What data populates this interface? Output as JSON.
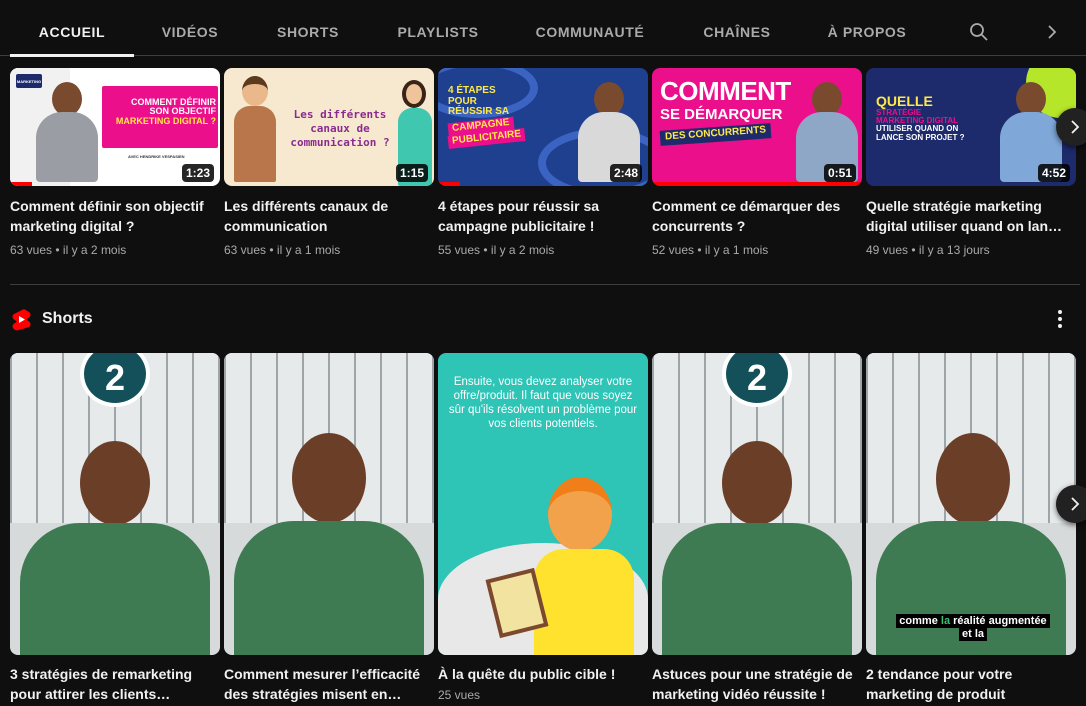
{
  "tabs": [
    {
      "label": "ACCUEIL"
    },
    {
      "label": "VIDÉOS"
    },
    {
      "label": "SHORTS"
    },
    {
      "label": "PLAYLISTS"
    },
    {
      "label": "COMMUNAUTÉ"
    },
    {
      "label": "CHAÎNES"
    },
    {
      "label": "À PROPOS"
    }
  ],
  "tab_icons": {
    "search": "search-icon",
    "next": "chevron-right-icon"
  },
  "videos": [
    {
      "title": "Comment définir son objectif marketing digital ?",
      "views": "63 vues",
      "age": "il y a 2 mois",
      "duration": "1:23",
      "watched": 0.1,
      "thumb_text": [
        "COMMENT DÉFINIR",
        "SON OBJECTIF",
        "MARKETING DIGITAL ?"
      ],
      "thumb_sub": "AVEC HENDRIKE VESPASIEN",
      "thumb_logo": "MARKETING"
    },
    {
      "title": "Les différents canaux de communication",
      "views": "63 vues",
      "age": "il y a 1 mois",
      "duration": "1:15",
      "watched": 0,
      "thumb_text": [
        "Les différents",
        "canaux de",
        "communication ?"
      ]
    },
    {
      "title": "4 étapes pour réussir sa campagne publicitaire !",
      "views": "55 vues",
      "age": "il y a 2 mois",
      "duration": "2:48",
      "watched": 0.1,
      "thumb_text": [
        "4 ÉTAPES",
        "POUR",
        "RÉUSSIR SA",
        "CAMPAGNE",
        "PUBLICITAIRE"
      ]
    },
    {
      "title": "Comment ce démarquer des concurrents ?",
      "views": "52 vues",
      "age": "il y a 1 mois",
      "duration": "0:51",
      "watched": 1,
      "thumb_text": [
        "COMMENT",
        "SE DÉMARQUER",
        "DES CONCURRENTS"
      ]
    },
    {
      "title": "Quelle stratégie marketing digital utiliser quand on lan…",
      "views": "49 vues",
      "age": "il y a 13 jours",
      "duration": "4:52",
      "watched": 0,
      "thumb_text": [
        "QUELLE",
        "STRATÉGIE",
        "MARKETING DIGITAL",
        "UTILISER QUAND ON",
        "LANCE SON PROJET ?"
      ]
    }
  ],
  "meta_separator": "•",
  "shorts_shelf": {
    "title": "Shorts",
    "icon": "shorts-logo-icon",
    "menu_icon": "more-vert-icon"
  },
  "shorts": [
    {
      "title": "3 stratégies de remarketing pour attirer les clients…",
      "badge": "2"
    },
    {
      "title": "Comment mesurer l’efficacité des stratégies misent en…"
    },
    {
      "title": "À la quête du public cible !",
      "views": "25 vues",
      "overlay_text": "Ensuite, vous devez analyser votre offre/produit. Il faut que vous soyez sûr qu'ils résolvent un problème pour vos clients potentiels."
    },
    {
      "title": "Astuces pour une stratégie de marketing vidéo réussite !",
      "badge": "2"
    },
    {
      "title": "2 tendance pour votre marketing de produit",
      "caption_line1_a": "comme",
      "caption_line1_b": "la",
      "caption_line1_c": "réalité augmentée",
      "caption_line2": "et la"
    }
  ],
  "colors": {
    "background": "#0f0f0f",
    "accent_red": "#ff0000",
    "secondary_text": "#aaaaaa",
    "pink": "#ec0f8c",
    "navy": "#1d2a6b"
  }
}
